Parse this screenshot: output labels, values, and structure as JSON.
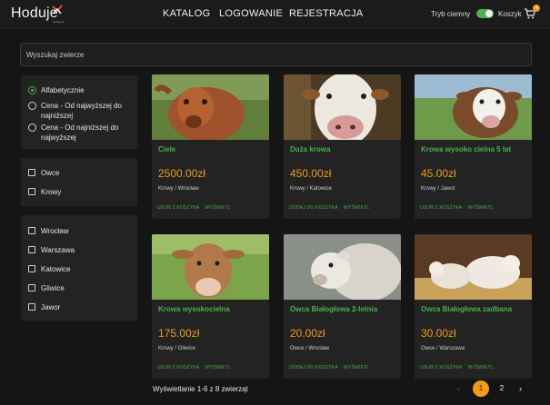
{
  "header": {
    "logo": "Hoduje",
    "logo_sub": "hoduje.pl",
    "nav": [
      "KATALOG",
      "LOGOWANIE",
      "REJESTRACJA"
    ],
    "dark_mode_label": "Tryb ciemny",
    "dark_mode_on": true,
    "cart_label": "Koszyk",
    "cart_count": "4"
  },
  "search": {
    "placeholder": "Wyszukaj zwierze",
    "value": ""
  },
  "sort": {
    "options": [
      "Alfabetycznie",
      "Cena - Od najwyższej do najniższej",
      "Cena - Od najniższej do najwyższej"
    ],
    "selected": 0
  },
  "species": [
    "Owce",
    "Krowy"
  ],
  "cities": [
    "Wrocław",
    "Warszawa",
    "Katowice",
    "Gliwice",
    "Jawor"
  ],
  "products": [
    {
      "title": "Ciele",
      "price": "2500.00zł",
      "meta": "Krowy / Wrocław",
      "action": "USUŃ Z KOSZYKA",
      "view": "WYŚWIETL",
      "image": "brown-calf"
    },
    {
      "title": "Duża krowa",
      "price": "450.00zł",
      "meta": "Krowy / Katowice",
      "action": "DODAJ DO KOSZYKA",
      "view": "WYŚWIETL",
      "image": "white-face-cow"
    },
    {
      "title": "Krowa wysoko cielna 5 lat",
      "price": "45.00zł",
      "meta": "Krowy / Jawor",
      "action": "USUŃ Z KOSZYKA",
      "view": "WYŚWIETL",
      "image": "brown-white-cow"
    },
    {
      "title": "Krowa wysokocielna",
      "price": "175.00zł",
      "meta": "Krowy / Gliwice",
      "action": "USUŃ Z KOSZYKA",
      "view": "WYŚWIETL",
      "image": "young-cow-meadow"
    },
    {
      "title": "Owca Białogłowa 2-letnia",
      "price": "20.00zł",
      "meta": "Owce / Wrocław",
      "action": "DODAJ DO KOSZYKA",
      "view": "WYŚWIETL",
      "image": "sheep-head"
    },
    {
      "title": "Owca Białogłowa zadbana",
      "price": "30.00zł",
      "meta": "Owce / Warszawa",
      "action": "USUŃ Z KOSZYKA",
      "view": "WYŚWIETL",
      "image": "lambs-barn"
    }
  ],
  "footer": {
    "results": "Wyświetlanie 1-6 z 8 zwierząt",
    "pages": [
      "1",
      "2"
    ],
    "current_page": "1"
  },
  "colors": {
    "accent": "#4caf50",
    "price": "#f39c12",
    "background": "#151515",
    "panel": "#232323"
  }
}
